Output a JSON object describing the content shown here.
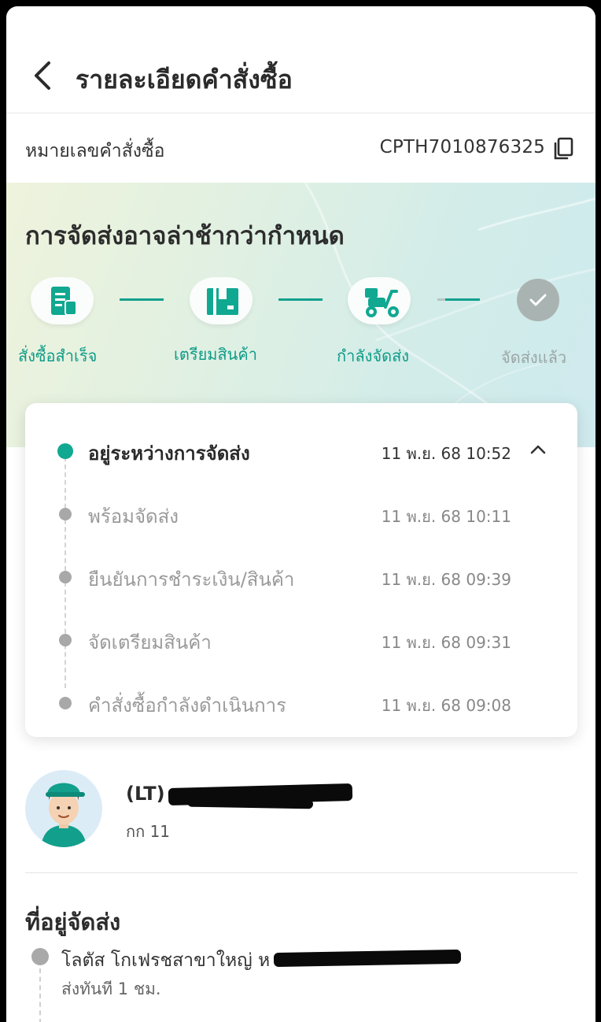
{
  "header": {
    "title": "รายละเอียดคำสั่งซื้อ"
  },
  "order": {
    "label": "หมายเลขคำสั่งซื้อ",
    "number": "CPTH7010876325"
  },
  "status": {
    "title": "การจัดส่งอาจล่าช้ากว่ากำหนด",
    "steps": [
      {
        "label": "สั่งซื้อสำเร็จ",
        "icon": "receipt-icon",
        "state": "done"
      },
      {
        "label": "เตรียมสินค้า",
        "icon": "box-icon",
        "state": "done"
      },
      {
        "label": "กำลังจัดส่ง",
        "icon": "scooter-icon",
        "state": "current"
      },
      {
        "label": "จัดส่งแล้ว",
        "icon": "check-icon",
        "state": "pending"
      }
    ]
  },
  "timeline": [
    {
      "text": "อยู่ระหว่างการจัดส่ง",
      "time": "11 พ.ย. 68 10:52",
      "active": true
    },
    {
      "text": "พร้อมจัดส่ง",
      "time": "11 พ.ย. 68 10:11",
      "active": false
    },
    {
      "text": "ยืนยันการชำระเงิน/สินค้า",
      "time": "11 พ.ย. 68 09:39",
      "active": false
    },
    {
      "text": "จัดเตรียมสินค้า",
      "time": "11 พ.ย. 68 09:31",
      "active": false
    },
    {
      "text": "คำสั่งซื้อกำลังดำเนินการ",
      "time": "11 พ.ย. 68 09:08",
      "active": false
    }
  ],
  "driver": {
    "name_prefix": "(LT)",
    "plate": "กก 11"
  },
  "address": {
    "title": "ที่อยู่จัดส่ง",
    "store": "โลตัส โกเฟรชสาขาใหญ่ ห",
    "eta": "ส่งทันที 1 ชม."
  },
  "colors": {
    "accent": "#10a891",
    "pending": "#a9b3b1"
  }
}
